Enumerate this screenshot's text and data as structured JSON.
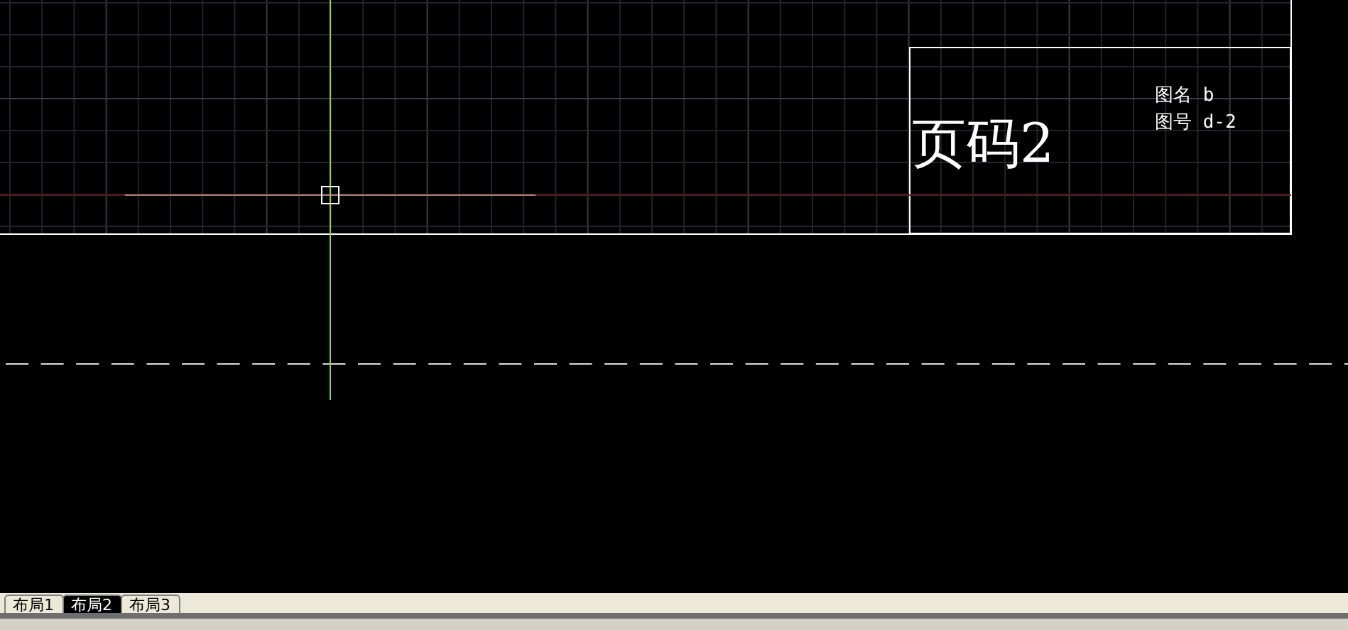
{
  "title_block": {
    "page_label": "页码2",
    "drawing_name": "图名 b",
    "drawing_number": "图号 d-2"
  },
  "layout_tabs": [
    {
      "label": "布局1",
      "selected": false
    },
    {
      "label": "布局2",
      "selected": true
    },
    {
      "label": "布局3",
      "selected": false
    }
  ]
}
